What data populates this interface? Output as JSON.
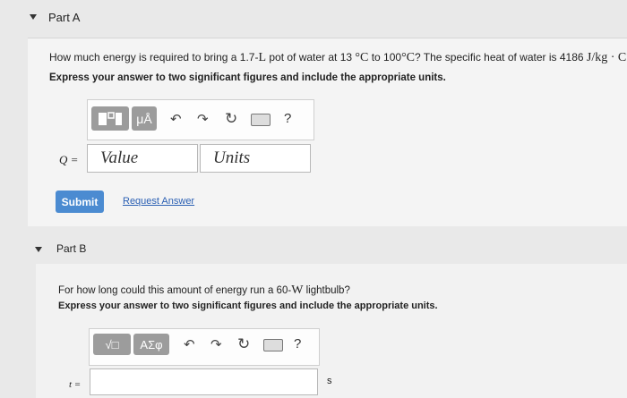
{
  "part_a": {
    "header": "Part A",
    "question_pre": "How much energy is required to bring a 1.7-",
    "unit_L": "L",
    "question_mid1": " pot of water at 13 ",
    "deg_C": "°C",
    "question_mid2": " to 100",
    "deg_C2": "°C",
    "question_mid3": "? The specific heat of water is 4186 ",
    "unit_heat": "J/kg · C°",
    "question_end": ".",
    "instruction": "Express your answer to two significant figures and include the appropriate units.",
    "toolbar": {
      "templates": "",
      "units_btn": "μÅ",
      "undo": "↶",
      "redo": "↷",
      "reset": "↻",
      "help": "?"
    },
    "var_label": "Q =",
    "value_placeholder": "Value",
    "units_placeholder": "Units",
    "submit": "Submit",
    "request_answer": "Request Answer"
  },
  "part_b": {
    "header": "Part B",
    "question_pre": "For how long could this amount of energy run a 60-",
    "unit_W": "W",
    "question_end": " lightbulb?",
    "instruction": "Express your answer to two significant figures and include the appropriate units.",
    "toolbar": {
      "templates": "√□",
      "greek_btn": "ΑΣφ",
      "undo": "↶",
      "redo": "↷",
      "reset": "↻",
      "help": "?"
    },
    "var_label": "t =",
    "unit_suffix": "s"
  }
}
